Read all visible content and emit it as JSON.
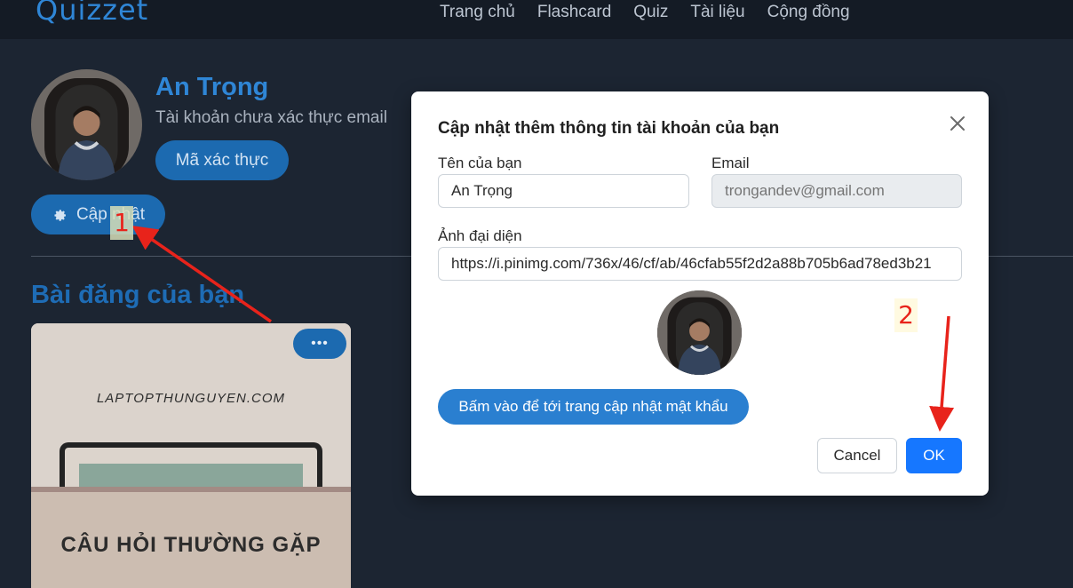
{
  "navbar": {
    "logo": "Quizzet",
    "links": [
      "Trang chủ",
      "Flashcard",
      "Quiz",
      "Tài liệu",
      "Cộng đồng"
    ]
  },
  "profile": {
    "name": "An Trọng",
    "verify_status": "Tài khoản chưa xác thực email",
    "verify_button": "Mã xác thực",
    "update_button": "Cập nhật"
  },
  "posts": {
    "title": "Bài đăng của bạn",
    "card": {
      "site": "LAPTOPTHUNGUYEN.COM",
      "caption": "CÂU HỎI THƯỜNG GẶP",
      "more_button": "•••"
    }
  },
  "modal": {
    "title": "Cập nhật thêm thông tin tài khoản của bạn",
    "name_label": "Tên của bạn",
    "name_value": "An Trọng",
    "email_label": "Email",
    "email_placeholder": "trongandev@gmail.com",
    "avatar_label": "Ảnh đại diện",
    "avatar_url": "https://i.pinimg.com/736x/46/cf/ab/46cfab55f2d2a88b705b6ad78ed3b21",
    "password_button": "Bấm vào để tới trang cập nhật mật khẩu",
    "cancel_button": "Cancel",
    "ok_button": "OK"
  },
  "annotations": {
    "step1": "1",
    "step2": "2",
    "color": "#e8231b"
  },
  "colors": {
    "accent": "#1c6ab0",
    "primary": "#1677ff",
    "background": "#1c2532"
  }
}
